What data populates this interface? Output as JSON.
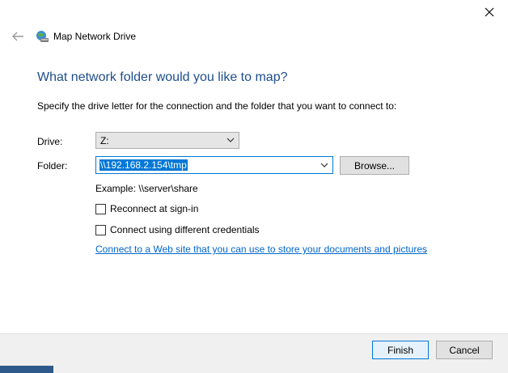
{
  "window": {
    "title": "Map Network Drive",
    "close_glyph": "✕"
  },
  "heading": "What network folder would you like to map?",
  "instructions": "Specify the drive letter for the connection and the folder that you want to connect to:",
  "drive": {
    "label": "Drive:",
    "value": "Z:"
  },
  "folder": {
    "label": "Folder:",
    "value": "\\\\192.168.2.154\\tmp",
    "browse_label": "Browse..."
  },
  "example": "Example: \\\\server\\share",
  "options": {
    "reconnect": {
      "label": "Reconnect at sign-in",
      "checked": false
    },
    "credentials": {
      "label": "Connect using different credentials",
      "checked": false
    }
  },
  "link": {
    "text": "Connect to a Web site that you can use to store your documents and pictures",
    "suffix": "."
  },
  "buttons": {
    "finish": "Finish",
    "cancel": "Cancel"
  },
  "colors": {
    "heading": "#1f4e8c",
    "accent": "#0078d7",
    "link": "#0066cc"
  }
}
